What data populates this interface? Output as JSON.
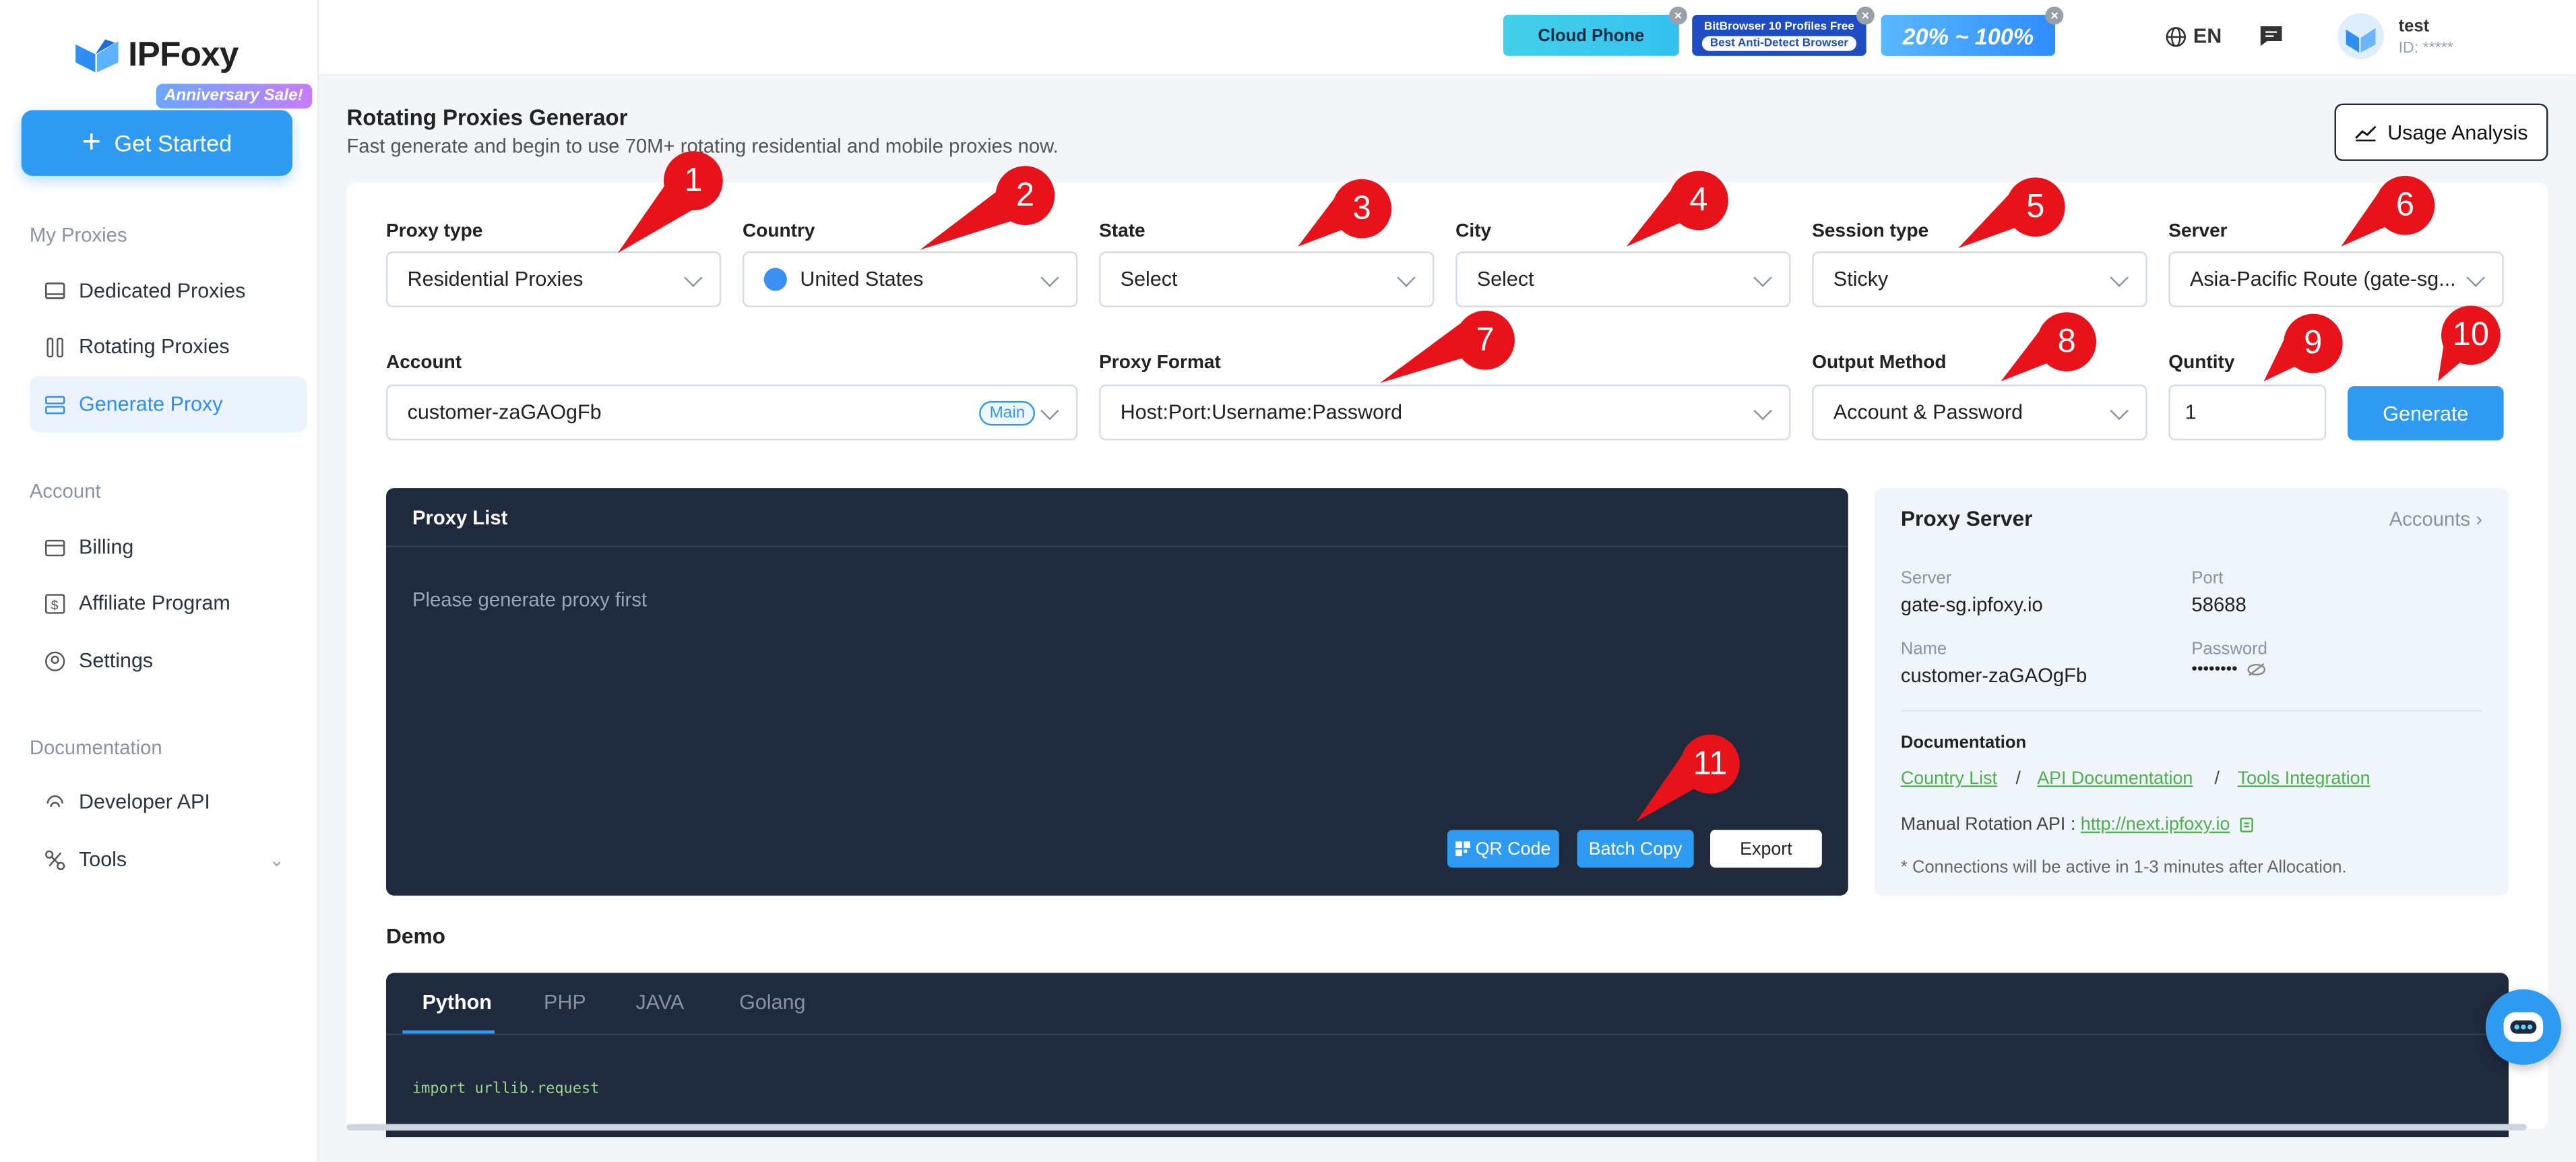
{
  "brand": {
    "name": "IPFoxy",
    "sale_badge": "Anniversary Sale!"
  },
  "sidebar": {
    "get_started": "Get Started",
    "sections": [
      {
        "title": "My Proxies",
        "items": [
          "Dedicated Proxies",
          "Rotating Proxies",
          "Generate Proxy"
        ]
      },
      {
        "title": "Account",
        "items": [
          "Billing",
          "Affiliate Program",
          "Settings"
        ]
      },
      {
        "title": "Documentation",
        "items": [
          "Developer API",
          "Tools"
        ]
      }
    ]
  },
  "topbar": {
    "banners": {
      "cloud_phone": "Cloud Phone",
      "bitbrowser_l1": "BitBrowser  10 Profiles Free",
      "bitbrowser_l2": "Best Anti-Detect Browser",
      "promo": "20% ~ 100%"
    },
    "language": "EN",
    "user": {
      "name": "test",
      "id": "ID: *****"
    }
  },
  "page": {
    "title": "Rotating Proxies Generaor",
    "subtitle": "Fast generate and begin to use 70M+ rotating residential and mobile proxies now.",
    "usage_button": "Usage Analysis"
  },
  "form": {
    "proxy_type": {
      "label": "Proxy type",
      "value": "Residential Proxies"
    },
    "country": {
      "label": "Country",
      "value": "United States"
    },
    "state": {
      "label": "State",
      "value": "Select"
    },
    "city": {
      "label": "City",
      "value": "Select"
    },
    "session_type": {
      "label": "Session type",
      "value": "Sticky"
    },
    "server": {
      "label": "Server",
      "value": "Asia-Pacific Route (gate-sg..."
    },
    "account": {
      "label": "Account",
      "value": "customer-zaGAOgFb",
      "badge": "Main"
    },
    "proxy_format": {
      "label": "Proxy Format",
      "value": "Host:Port:Username:Password"
    },
    "output_method": {
      "label": "Output Method",
      "value": "Account & Password"
    },
    "quantity": {
      "label": "Quntity",
      "value": "1"
    },
    "generate": "Generate"
  },
  "proxy_list": {
    "title": "Proxy List",
    "empty": "Please generate proxy first",
    "buttons": {
      "qr": "QR Code",
      "batch_copy": "Batch Copy",
      "export": "Export"
    }
  },
  "proxy_server": {
    "title": "Proxy Server",
    "accounts_link": "Accounts",
    "server_label": "Server",
    "server": "gate-sg.ipfoxy.io",
    "port_label": "Port",
    "port": "58688",
    "name_label": "Name",
    "name": "customer-zaGAOgFb",
    "password_label": "Password",
    "password": "••••••••",
    "doc_title": "Documentation",
    "links": [
      "Country List",
      "API Documentation",
      "Tools Integration"
    ],
    "rotation_label": "Manual Rotation API :",
    "rotation_url": "http://next.ipfoxy.io",
    "note": "* Connections will be active in 1-3 minutes after Allocation."
  },
  "demo": {
    "title": "Demo",
    "tabs": [
      "Python",
      "PHP",
      "JAVA",
      "Golang"
    ],
    "code": "import urllib.request"
  },
  "annotations": [
    "1",
    "2",
    "3",
    "4",
    "5",
    "6",
    "7",
    "8",
    "9",
    "10",
    "11"
  ],
  "colors": {
    "accent": "#2f9bf0",
    "dark_panel": "#1f2a3d",
    "marker": "#e8121a",
    "link": "#4cb04c"
  }
}
